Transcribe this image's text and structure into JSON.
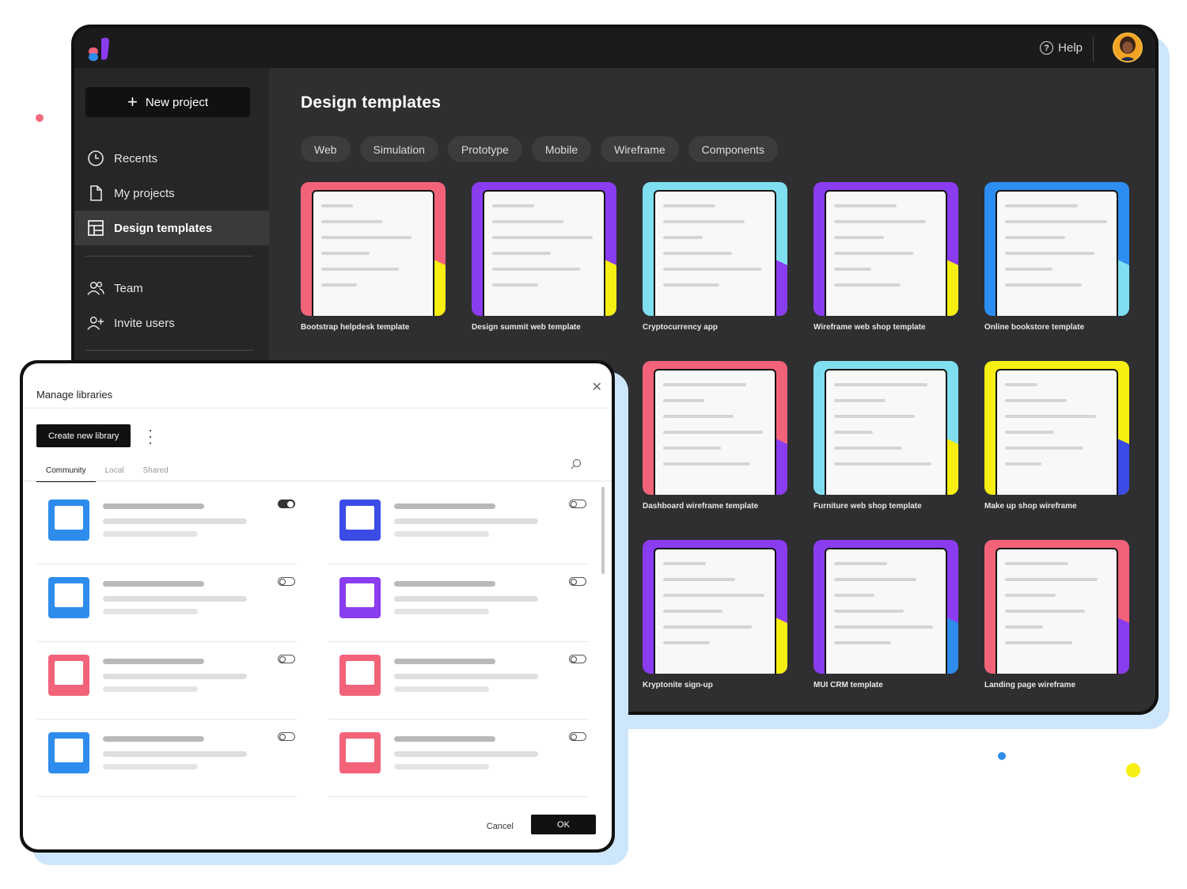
{
  "topbar": {
    "help_label": "Help"
  },
  "sidebar": {
    "new_project_label": "New project",
    "items": [
      {
        "label": "Recents",
        "icon": "clock-icon"
      },
      {
        "label": "My projects",
        "icon": "file-icon"
      },
      {
        "label": "Design templates",
        "icon": "layout-icon",
        "active": true
      },
      {
        "label": "Team",
        "icon": "team-icon"
      },
      {
        "label": "Invite users",
        "icon": "add-user-icon"
      }
    ]
  },
  "main": {
    "title": "Design templates",
    "tabs": [
      "Web",
      "Simulation",
      "Prototype",
      "Mobile",
      "Wireframe",
      "Components"
    ],
    "templates": [
      {
        "label": "Bootstrap helpdesk template",
        "color": "#f2637a"
      },
      {
        "label": "Design summit web template",
        "color": "#8a3cf0"
      },
      {
        "label": "Cryptocurrency app",
        "color": "#7fdff0"
      },
      {
        "label": "Wireframe web shop template",
        "color": "#8a3cf0"
      },
      {
        "label": "Online bookstore template",
        "color": "#2c8ef0"
      },
      {
        "label": "Dashboard wireframe template",
        "color": "#f2637a"
      },
      {
        "label": "Furniture web shop template",
        "color": "#7fdff0"
      },
      {
        "label": "Make up shop wireframe",
        "color": "#f7ee12"
      },
      {
        "label": "Kryptonite sign-up",
        "color": "#8a3cf0"
      },
      {
        "label": "MUI CRM template",
        "color": "#8a3cf0"
      },
      {
        "label": "Landing page wireframe",
        "color": "#f2637a"
      }
    ]
  },
  "modal": {
    "title": "Manage libraries",
    "create_label": "Create new library",
    "tabs": [
      "Community",
      "Local",
      "Shared"
    ],
    "libraries": [
      {
        "thumb": "#2d8cec",
        "enabled": true
      },
      {
        "thumb": "#3a4be6",
        "enabled": false
      },
      {
        "thumb": "#2d8cec",
        "enabled": false
      },
      {
        "thumb": "#8a3cf0",
        "enabled": false
      },
      {
        "thumb": "#f2637a",
        "enabled": false
      },
      {
        "thumb": "#f2637a",
        "enabled": false
      },
      {
        "thumb": "#2d8cec",
        "enabled": false
      },
      {
        "thumb": "#f2637a",
        "enabled": false
      }
    ],
    "cancel_label": "Cancel",
    "ok_label": "OK"
  }
}
